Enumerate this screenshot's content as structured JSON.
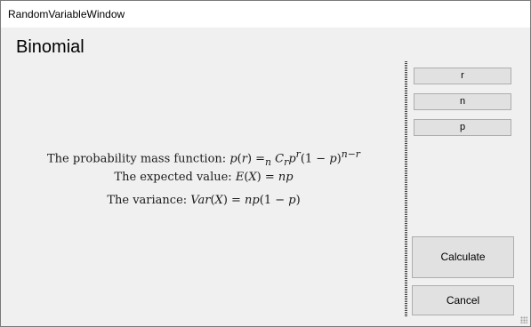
{
  "window": {
    "title": "RandomVariableWindow"
  },
  "heading": "Binomial",
  "formulas": {
    "pmf_label": "The probability mass function: ",
    "expected_label": "The expected value: ",
    "variance_label": "The variance: "
  },
  "buttons": {
    "r": "r",
    "n": "n",
    "p": "p",
    "calculate": "Calculate",
    "cancel": "Cancel"
  }
}
